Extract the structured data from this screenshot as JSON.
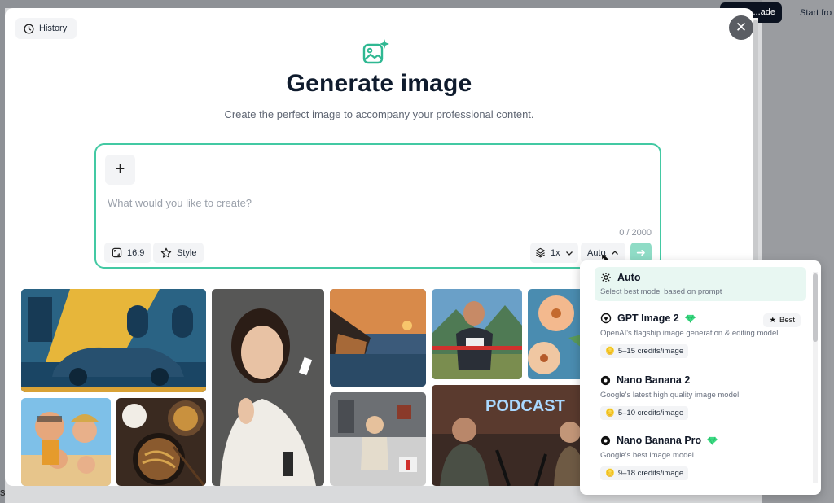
{
  "background": {
    "top_button_label": "...ade",
    "start_label": "Start fro",
    "bottom_left_text": "s"
  },
  "modal": {
    "history_label": "History",
    "close_icon": "close-icon",
    "title": "Generate image",
    "subtitle": "Create the perfect image to accompany your professional content.",
    "prompt": {
      "placeholder": "What would you like to create?",
      "value": "",
      "counter": "0 / 2000",
      "ratio_label": "16:9",
      "style_label": "Style",
      "count_label": "1x",
      "model_label": "Auto"
    },
    "accent_color": "#43c9a3"
  },
  "model_dropdown": {
    "items": [
      {
        "name": "Auto",
        "description": "Select best model based on prompt",
        "icon": "gear-icon",
        "selected": true
      },
      {
        "name": "GPT Image 2",
        "description": "OpenAI's flagship image generation & editing model",
        "icon": "openai-icon",
        "premium": true,
        "badge": "Best",
        "credits": "5–15 credits/image"
      },
      {
        "name": "Nano Banana 2",
        "description": "Google's latest high quality image model",
        "icon": "banana-icon",
        "credits": "5–10 credits/image"
      },
      {
        "name": "Nano Banana Pro",
        "description": "Google's best image model",
        "icon": "banana-icon",
        "premium": true,
        "credits": "9–18 credits/image"
      }
    ]
  },
  "gallery": {
    "podcast_sign": "PODCAST"
  }
}
